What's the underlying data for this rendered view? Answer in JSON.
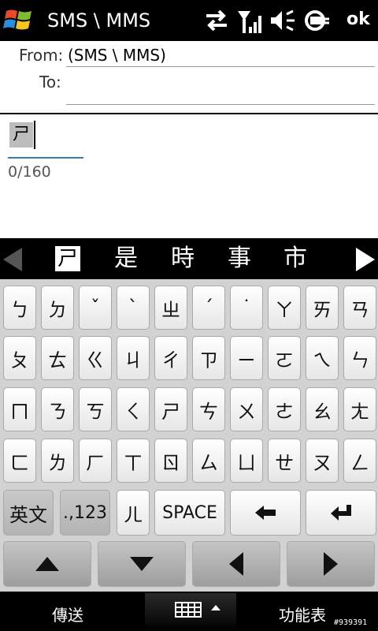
{
  "titlebar": {
    "title": "SMS \\ MMS",
    "ok_label": "ok",
    "icons": [
      "sync-arrows-icon",
      "signal-strength-icon",
      "speaker-mute-icon",
      "battery-charging-icon"
    ]
  },
  "header": {
    "from_label": "From:",
    "from_value": "(SMS \\ MMS)",
    "to_label": "To:",
    "to_value": ""
  },
  "compose": {
    "composing_char": "ㄕ",
    "counter": "0/160"
  },
  "candidates": {
    "items": [
      "ㄕ",
      "是",
      "時",
      "事",
      "市"
    ],
    "selected_index": 0
  },
  "keyboard": {
    "rows": [
      [
        "ㄅ",
        "ㄉ",
        "ˇ",
        "ˋ",
        "ㄓ",
        "ˊ",
        "˙",
        "ㄚ",
        "ㄞ",
        "ㄢ"
      ],
      [
        "ㄆ",
        "ㄊ",
        "ㄍ",
        "ㄐ",
        "ㄔ",
        "ㄗ",
        "ㄧ",
        "ㄛ",
        "ㄟ",
        "ㄣ"
      ],
      [
        "ㄇ",
        "ㄋ",
        "ㄎ",
        "ㄑ",
        "ㄕ",
        "ㄘ",
        "ㄨ",
        "ㄜ",
        "ㄠ",
        "ㄤ"
      ],
      [
        "ㄈ",
        "ㄌ",
        "ㄏ",
        "ㄒ",
        "ㄖ",
        "ㄙ",
        "ㄩ",
        "ㄝ",
        "ㄡ",
        "ㄥ"
      ]
    ],
    "row5": {
      "english_label": "英文",
      "numbers_label": ".,123",
      "er_label": "ㄦ",
      "space_label": "SPACE",
      "backspace_icon": "backspace-arrow-icon",
      "enter_icon": "enter-return-icon"
    },
    "row6_icons": [
      "arrow-up-icon",
      "arrow-down-icon",
      "arrow-left-icon",
      "arrow-right-icon"
    ]
  },
  "softbar": {
    "left_label": "傳送",
    "right_label": "功能表",
    "middle_icon": "keyboard-input-icon"
  },
  "watermark": "#939391",
  "colors": {
    "accent_underline": "#2f7fb5",
    "keyboard_bg": "#d2d2d2",
    "bar_bg": "#000000"
  }
}
